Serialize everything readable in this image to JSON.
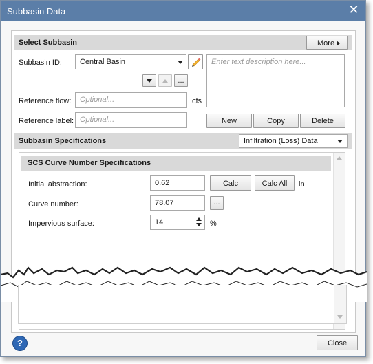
{
  "window": {
    "title": "Subbasin Data",
    "close_icon": "✕"
  },
  "select_subbasin": {
    "header": "Select Subbasin",
    "more_label": "More",
    "subbasin_id_label": "Subbasin ID:",
    "subbasin_id_value": "Central Basin",
    "description_placeholder": "Enter text description here...",
    "nav_ellipsis": "...",
    "reference_flow_label": "Reference flow:",
    "reference_flow_placeholder": "Optional...",
    "reference_flow_unit": "cfs",
    "reference_label_label": "Reference label:",
    "reference_label_placeholder": "Optional...",
    "new_label": "New",
    "copy_label": "Copy",
    "delete_label": "Delete"
  },
  "specs": {
    "header": "Subbasin Specifications",
    "selected_option": "Infiltration (Loss) Data",
    "scs_header": "SCS Curve Number Specifications",
    "initial_abstraction_label": "Initial abstraction:",
    "initial_abstraction_value": "0.62",
    "calc_label": "Calc",
    "calc_all_label": "Calc All",
    "initial_abstraction_unit": "in",
    "curve_number_label": "Curve number:",
    "curve_number_value": "78.07",
    "curve_number_ellipsis": "...",
    "impervious_label": "Impervious surface:",
    "impervious_value": "14",
    "impervious_unit": "%"
  },
  "footer": {
    "help_glyph": "?",
    "close_label": "Close"
  },
  "colors": {
    "titlebar": "#5b7ea8",
    "section_header": "#d9d9d9",
    "help_button": "#2f68b5"
  }
}
